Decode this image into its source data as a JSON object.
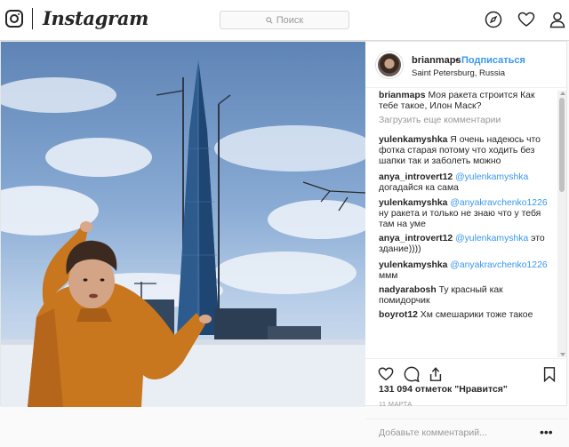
{
  "app": {
    "name": "Instagram"
  },
  "search": {
    "placeholder": "Поиск"
  },
  "post": {
    "username": "brianmaps",
    "dot": "•",
    "follow_label": "Подписаться",
    "location": "Saint Petersburg, Russia",
    "caption": "Моя ракета строится Как тебе такое, Илон Маск?",
    "load_more": "Загрузить еще комментарии",
    "comments": [
      {
        "author": "yulenkamyshka",
        "text": "Я очень надеюсь что фотка старая потому что ходить без шапки так и заболеть можно"
      },
      {
        "author": "anya_introvert12",
        "mention": "@yulenkamyshka",
        "text": "догадайся ка сама"
      },
      {
        "author": "yulenkamyshka",
        "mention": "@anyakravchenko1226",
        "text": "ну ракета и только не знаю что у тебя там на уме"
      },
      {
        "author": "anya_introvert12",
        "mention": "@yulenkamyshka",
        "text": "это здание))))"
      },
      {
        "author": "yulenkamyshka",
        "mention": "@anyakravchenko1226",
        "text": "ммм"
      },
      {
        "author": "nadyarabosh",
        "text": "Ту красный как помидорчик"
      },
      {
        "author": "boyrot12",
        "text": "Хм смешарики тоже такое"
      }
    ],
    "likes": "131 094 отметок \"Нравится\"",
    "date": "11 МАРТА",
    "add_comment_placeholder": "Добавьте комментарий...",
    "more_label": "•••"
  },
  "icons": {
    "logo": "instagram-camera-icon",
    "explore": "compass-icon",
    "activity": "heart-icon",
    "profile": "person-icon",
    "like": "heart-icon",
    "comment": "speech-bubble-icon",
    "share": "share-icon",
    "save": "bookmark-icon"
  },
  "colors": {
    "link": "#3897f0",
    "text": "#262626",
    "muted": "#999999",
    "border": "#dbdbdb"
  }
}
